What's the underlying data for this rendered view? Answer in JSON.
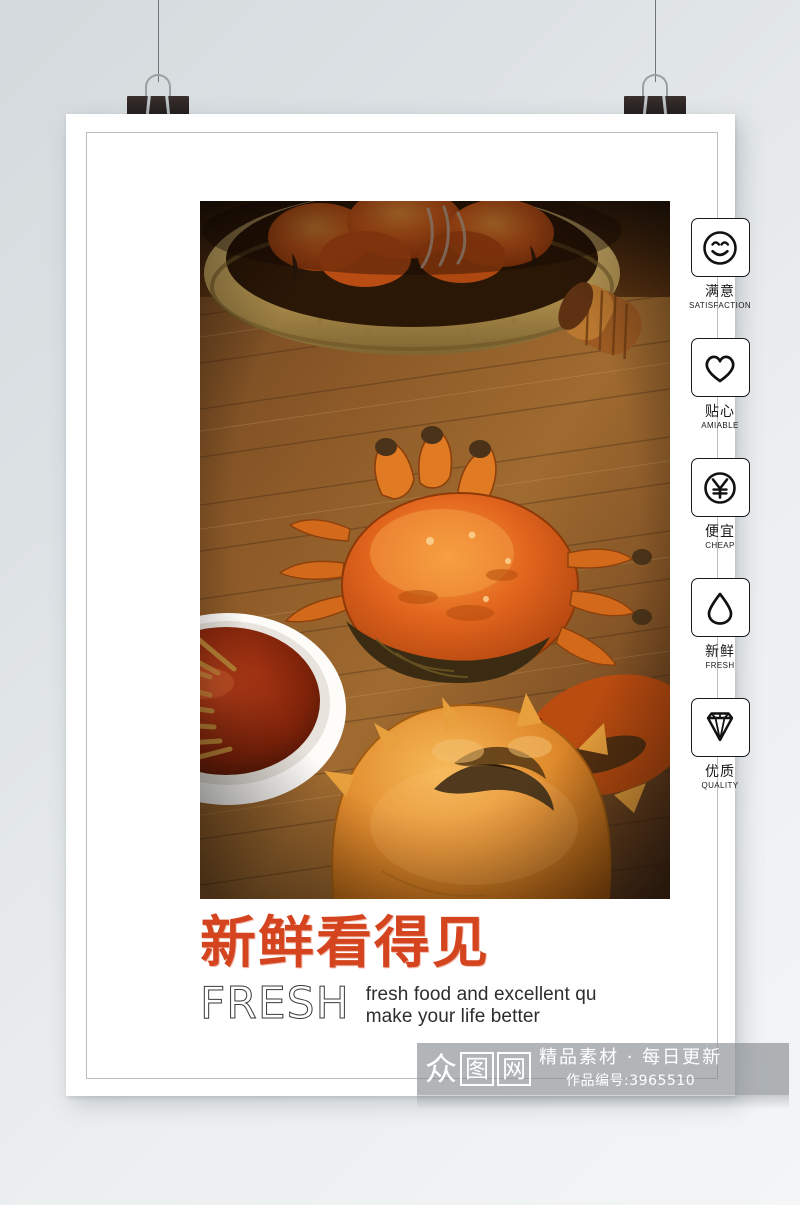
{
  "poster": {
    "headline_cn": "新鲜看得见",
    "headline_fresh": "FRESH",
    "tagline_line1": "fresh food and excellent qu",
    "tagline_line2": "make your life better",
    "accent_color": "#d4441f",
    "photo_alt": "steamed hairy crabs on a wooden table with dipping sauce bowl and bamboo steamer"
  },
  "features": [
    {
      "icon": "smiley-face-icon",
      "cn": "满意",
      "en": "SATISFACTION"
    },
    {
      "icon": "heart-icon",
      "cn": "贴心",
      "en": "AMIABLE"
    },
    {
      "icon": "yen-coin-icon",
      "cn": "便宜",
      "en": "CHEAP"
    },
    {
      "icon": "water-drop-icon",
      "cn": "新鲜",
      "en": "FRESH"
    },
    {
      "icon": "diamond-icon",
      "cn": "优质",
      "en": "QUALITY"
    }
  ],
  "watermark": {
    "logo_1": "众",
    "logo_2": "图",
    "logo_3": "网",
    "tagline": "精品素材 · 每日更新",
    "work_id": "作品编号:3965510"
  },
  "clips": {
    "clip_left_label": "binder-clip-left",
    "clip_right_label": "binder-clip-right"
  }
}
